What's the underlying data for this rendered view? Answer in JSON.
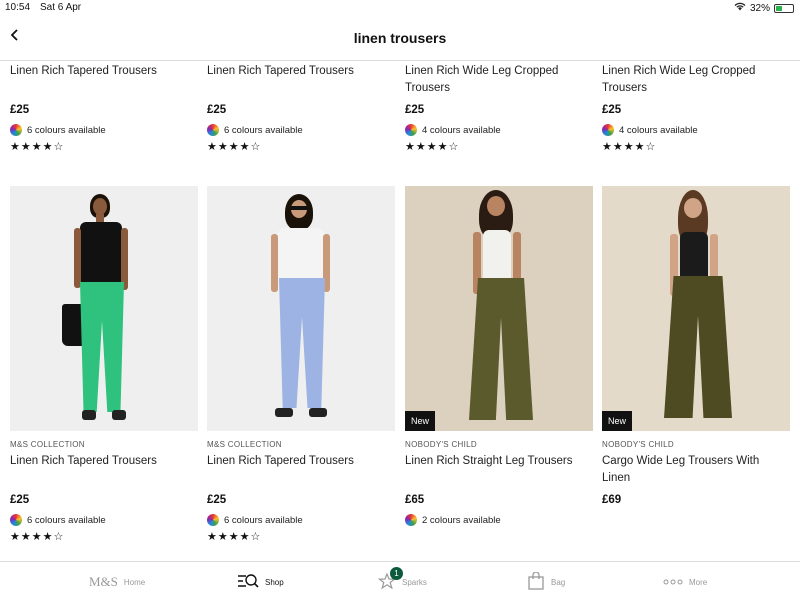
{
  "status": {
    "time": "10:54",
    "date": "Sat 6 Apr",
    "battery": "32%"
  },
  "header": {
    "title": "linen trousers",
    "back_icon": "chevron-left-icon"
  },
  "row1": [
    {
      "name": "Linen Rich Tapered Trousers",
      "price": "£25",
      "colours": "6 colours available",
      "rating": "★★★★☆"
    },
    {
      "name": "Linen Rich Tapered Trousers",
      "price": "£25",
      "colours": "6 colours available",
      "rating": "★★★★☆"
    },
    {
      "name": "Linen Rich Wide Leg Cropped Trousers",
      "price": "£25",
      "colours": "4 colours available",
      "rating": "★★★★☆"
    },
    {
      "name": "Linen Rich Wide Leg Cropped Trousers",
      "price": "£25",
      "colours": "4 colours available",
      "rating": "★★★★☆"
    }
  ],
  "row2": [
    {
      "brand": "M&S COLLECTION",
      "name": "Linen Rich Tapered Trousers",
      "price": "£25",
      "colours": "6 colours available",
      "rating": "★★★★☆",
      "top_color": "#111111",
      "trouser_color": "#2ec27e",
      "bg": "#efefef"
    },
    {
      "brand": "M&S COLLECTION",
      "name": "Linen Rich Tapered Trousers",
      "price": "£25",
      "colours": "6 colours available",
      "rating": "★★★★☆",
      "top_color": "#f4f4f4",
      "trouser_color": "#9db3e3",
      "bg": "#efefef"
    },
    {
      "brand": "NOBODY'S CHILD",
      "name": "Linen Rich Straight Leg Trousers",
      "price": "£65",
      "colours": "2 colours available",
      "new_label": "New",
      "top_color": "#f1f1ee",
      "trouser_color": "#5a5a2c",
      "bg": "#dcd0bf"
    },
    {
      "brand": "NOBODY'S CHILD",
      "name": "Cargo Wide Leg Trousers With Linen",
      "price": "£69",
      "new_label": "New",
      "top_color": "#1b1b1b",
      "trouser_color": "#4e4a22",
      "bg": "#e4dac9"
    }
  ],
  "tabs": [
    {
      "label": "Home",
      "logo": "M&S"
    },
    {
      "label": "Shop",
      "icon": "shop-search-icon"
    },
    {
      "label": "Sparks",
      "icon": "star-icon",
      "badge": "1"
    },
    {
      "label": "Bag",
      "icon": "bag-icon"
    },
    {
      "label": "More",
      "icon": "more-dots-icon"
    }
  ]
}
